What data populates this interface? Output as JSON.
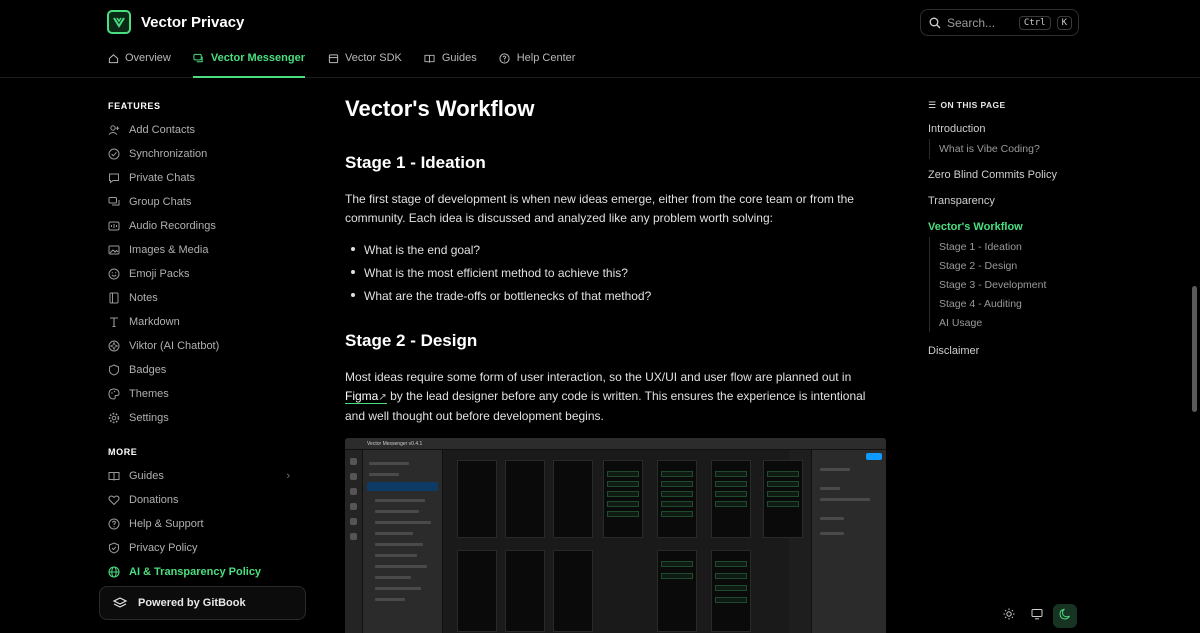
{
  "brand": {
    "name": "Vector Privacy"
  },
  "search": {
    "placeholder": "Search...",
    "key1": "Ctrl",
    "key2": "K"
  },
  "nav": [
    {
      "label": "Overview",
      "icon": "home-icon"
    },
    {
      "label": "Vector Messenger",
      "icon": "chat-icon",
      "active": true
    },
    {
      "label": "Vector SDK",
      "icon": "box-icon"
    },
    {
      "label": "Guides",
      "icon": "book-icon"
    },
    {
      "label": "Help Center",
      "icon": "help-circle-icon"
    }
  ],
  "sidebar": {
    "features_title": "FEATURES",
    "features": [
      {
        "label": "Add Contacts",
        "icon": "user-plus-icon"
      },
      {
        "label": "Synchronization",
        "icon": "sync-check-icon"
      },
      {
        "label": "Private Chats",
        "icon": "message-icon"
      },
      {
        "label": "Group Chats",
        "icon": "group-chat-icon"
      },
      {
        "label": "Audio Recordings",
        "icon": "microphone-icon"
      },
      {
        "label": "Images & Media",
        "icon": "image-icon"
      },
      {
        "label": "Emoji Packs",
        "icon": "emoji-icon"
      },
      {
        "label": "Notes",
        "icon": "notes-icon"
      },
      {
        "label": "Markdown",
        "icon": "text-icon"
      },
      {
        "label": "Viktor (AI Chatbot)",
        "icon": "bot-icon"
      },
      {
        "label": "Badges",
        "icon": "badge-icon"
      },
      {
        "label": "Themes",
        "icon": "palette-icon"
      },
      {
        "label": "Settings",
        "icon": "gear-icon"
      }
    ],
    "more_title": "MORE",
    "more": [
      {
        "label": "Guides",
        "icon": "book-icon",
        "has_children": true
      },
      {
        "label": "Donations",
        "icon": "heart-icon"
      },
      {
        "label": "Help & Support",
        "icon": "help-circle-icon"
      },
      {
        "label": "Privacy Policy",
        "icon": "shield-check-icon"
      },
      {
        "label": "AI & Transparency Policy",
        "icon": "globe-icon",
        "active": true
      }
    ],
    "powered_by": "Powered by GitBook"
  },
  "main": {
    "title": "Vector's Workflow",
    "stage1_heading": "Stage 1 - Ideation",
    "stage1_text": "The first stage of development is when new ideas emerge, either from the core team or from the community. Each idea is discussed and analyzed like any problem worth solving:",
    "stage1_bullets": [
      "What is the end goal?",
      "What is the most efficient method to achieve this?",
      "What are the trade-offs or bottlenecks of that method?"
    ],
    "stage2_heading": "Stage 2 - Design",
    "stage2_text_before": "Most ideas require some form of user interaction, so the UX/UI and user flow are planned out in ",
    "stage2_link": "Figma",
    "stage2_text_after": " by the lead designer before any code is written. This ensures the experience is intentional and well thought out before development begins.",
    "figma_title": "Vector Messenger v0.4.1"
  },
  "toc": {
    "title": "ON THIS PAGE",
    "items": [
      {
        "label": "Introduction",
        "level": 1
      },
      {
        "label": "What is Vibe Coding?",
        "level": 2
      },
      {
        "label": "Zero Blind Commits Policy",
        "level": 1
      },
      {
        "label": "Transparency",
        "level": 1
      },
      {
        "label": "Vector's Workflow",
        "level": 1,
        "active": true
      },
      {
        "label": "Stage 1 - Ideation",
        "level": 2
      },
      {
        "label": "Stage 2 - Design",
        "level": 2
      },
      {
        "label": "Stage 3 - Development",
        "level": 2
      },
      {
        "label": "Stage 4 - Auditing",
        "level": 2
      },
      {
        "label": "AI Usage",
        "level": 2
      },
      {
        "label": "Disclaimer",
        "level": 1
      }
    ]
  },
  "theme": {
    "selected": "dark"
  },
  "colors": {
    "accent": "#4ade80",
    "background": "#000000"
  }
}
